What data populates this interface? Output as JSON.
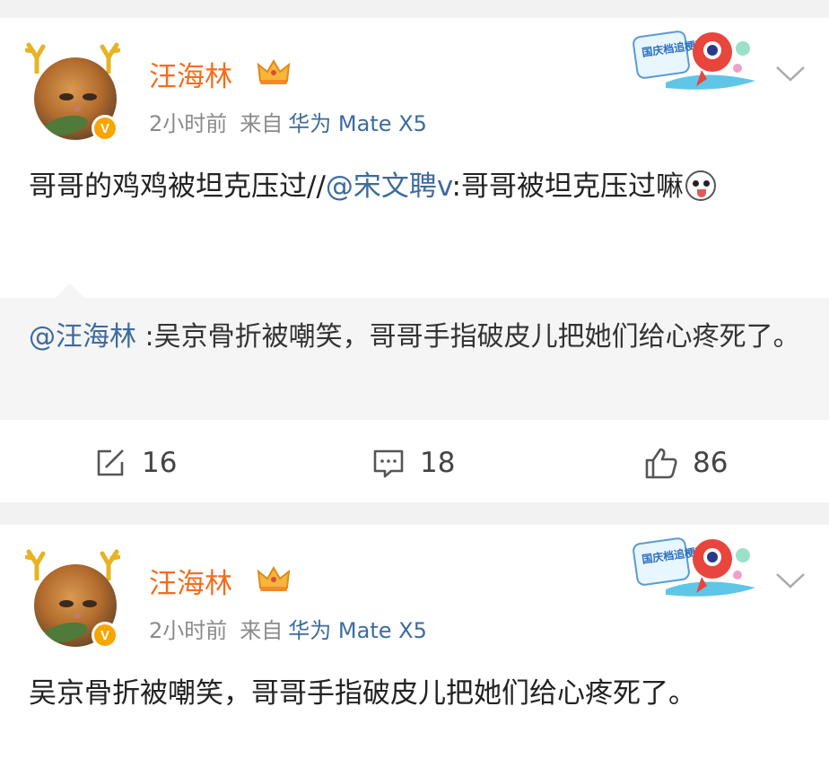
{
  "posts": [
    {
      "username": "汪海林",
      "time": "2小时前",
      "from_label": "来自",
      "device": "华为 Mate X5",
      "sticker_text": "国庆档追梗高手",
      "text_before_mention": "哥哥的鸡鸡被坦克压过//",
      "mention": "@宋文聘v",
      "text_after_mention": ":哥哥被坦克压过嘛",
      "quote": {
        "mention": "@汪海林",
        "text": " :吴京骨折被嘲笑，哥哥手指破皮儿把她们给心疼死了。"
      },
      "actions": {
        "repost_count": "16",
        "comment_count": "18",
        "like_count": "86"
      }
    },
    {
      "username": "汪海林",
      "time": "2小时前",
      "from_label": "来自",
      "device": "华为 Mate X5",
      "sticker_text": "国庆档追梗高手",
      "text": "吴京骨折被嘲笑，哥哥手指破皮儿把她们给心疼死了。"
    }
  ],
  "icons": {
    "verified": "verified-v-badge-icon",
    "crown": "crown-icon",
    "more": "chevron-down-icon",
    "repost": "repost-icon",
    "comment": "comment-icon",
    "like": "thumbs-up-icon"
  },
  "colors": {
    "username": "#f56c1c",
    "link": "#3d6b9c",
    "meta": "#8a8a8a",
    "verified": "#f7a500",
    "quote_bg": "#f5f5f5",
    "page_bg": "#f2f2f2"
  }
}
